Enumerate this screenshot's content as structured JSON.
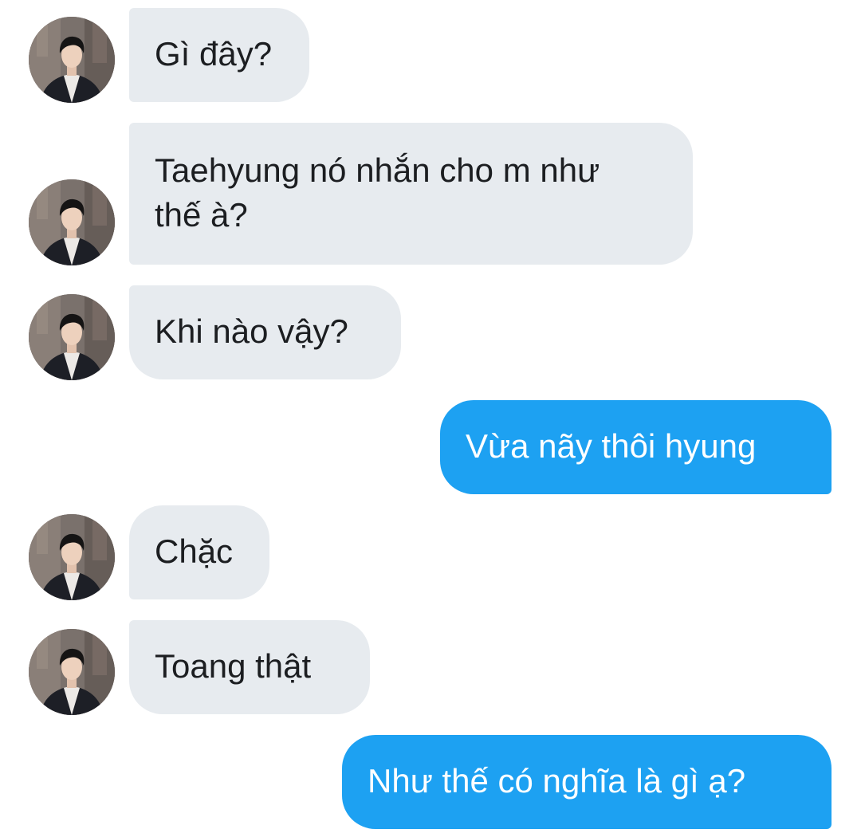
{
  "conversation": {
    "messages": [
      {
        "sender": "other",
        "text": "Gì đây?"
      },
      {
        "sender": "other",
        "text": "Taehyung nó nhắn cho m như thế à?"
      },
      {
        "sender": "other",
        "text": "Khi nào vậy?"
      },
      {
        "sender": "me",
        "text": "Vừa nãy thôi hyung"
      },
      {
        "sender": "other",
        "text": "Chặc"
      },
      {
        "sender": "other",
        "text": "Toang thật"
      },
      {
        "sender": "me",
        "text": "Như thế có nghĩa là gì ạ?"
      }
    ]
  },
  "colors": {
    "incoming_bubble": "#e7ebef",
    "outgoing_bubble": "#1da1f2",
    "incoming_text": "#1c1e21",
    "outgoing_text": "#ffffff"
  }
}
